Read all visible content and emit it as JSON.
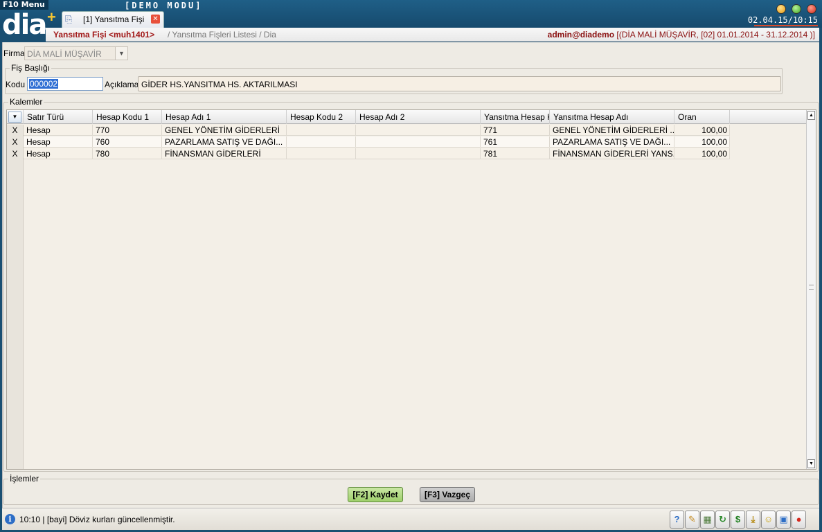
{
  "topbar": {
    "menu_label": "F10 Menu",
    "logo_text": "dia",
    "logo_mark": "®",
    "add_symbol": "+",
    "demo_label": "[DEMO   MODU]",
    "clock": "02.04.15/10:15",
    "window_buttons": [
      "minimize",
      "maximize",
      "close"
    ]
  },
  "tab": {
    "label": "[1] Yansıtma Fişi",
    "icon": "document-icon",
    "close_symbol": "✕"
  },
  "breadcrumb": {
    "title": "Yansıtma Fişi <muh1401>",
    "path": " / Yansıtma Fişleri Listesi / Dia",
    "user": "admin@diademo",
    "context": " [(DİA MALİ MÜŞAVİR, [02] 01.01.2014 - 31.12.2014 )]"
  },
  "form": {
    "firma_label": "Firma",
    "firma_value": "DİA MALİ MÜŞAVİR",
    "header_group": "Fiş Başlığı",
    "kodu_label": "Kodu",
    "kodu_value": "000002",
    "aciklama_label": "Açıklama",
    "aciklama_value": "GİDER HS.YANSITMA HS. AKTARILMASI",
    "items_group": "Kalemler",
    "actions_group": "İşlemler"
  },
  "grid": {
    "columns": [
      "Satır Türü",
      "Hesap Kodu 1",
      "Hesap Adı 1",
      "Hesap Kodu 2",
      "Hesap Adı 2",
      "Yansıtma Hesap K",
      "Yansıtma Hesap Adı",
      "Oran"
    ],
    "rows": [
      {
        "mark": "X",
        "satir_turu": "Hesap",
        "hesap_kodu_1": "770",
        "hesap_adi_1": "GENEL YÖNETİM GİDERLERİ",
        "hesap_kodu_2": "",
        "hesap_adi_2": "",
        "yansitma_kodu": "771",
        "yansitma_adi": "GENEL YÖNETİM GİDERLERİ ...",
        "oran": "100,00"
      },
      {
        "mark": "X",
        "satir_turu": "Hesap",
        "hesap_kodu_1": "760",
        "hesap_adi_1": "PAZARLAMA SATIŞ VE DAĞI...",
        "hesap_kodu_2": "",
        "hesap_adi_2": "",
        "yansitma_kodu": "761",
        "yansitma_adi": "PAZARLAMA SATIŞ VE DAĞI...",
        "oran": "100,00"
      },
      {
        "mark": "X",
        "satir_turu": "Hesap",
        "hesap_kodu_1": "780",
        "hesap_adi_1": "FİNANSMAN GİDERLERİ",
        "hesap_kodu_2": "",
        "hesap_adi_2": "",
        "yansitma_kodu": "781",
        "yansitma_adi": "FİNANSMAN GİDERLERİ YANS...",
        "oran": "100,00"
      }
    ]
  },
  "buttons": {
    "save": "[F2] Kaydet",
    "cancel": "[F3] Vazgeç"
  },
  "status": {
    "text": "10:10  |  [bayi] Döviz kurları güncellenmiştir.",
    "icons": [
      "help-icon",
      "wrench-icon",
      "calculator-icon",
      "refresh-icon",
      "currency-icon",
      "download-icon",
      "smiley-icon",
      "lock-icon",
      "stop-icon"
    ]
  },
  "colors": {
    "brand_dark": "#164a6d",
    "title_red": "#a11818",
    "save_green": "#9fcf6b",
    "selection_blue": "#2f6fd4"
  }
}
